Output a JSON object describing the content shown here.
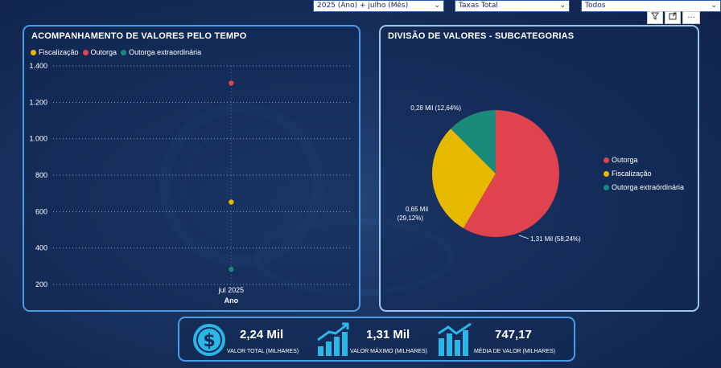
{
  "slicers": {
    "period": "2025 (Ano) + julho (Mês)",
    "taxa": "Taxas Total",
    "todos": "Todos"
  },
  "toolbar": {
    "filter_icon": "filter-icon",
    "focus_icon": "focus-mode-icon",
    "more_label": "···"
  },
  "timeline": {
    "title": "ACOMPANHAMENTO DE VALORES PELO TEMPO",
    "legend": [
      {
        "label": "Fiscalização",
        "color": "#e6b800"
      },
      {
        "label": "Outorga",
        "color": "#e0434d"
      },
      {
        "label": "Outorga extraordinária",
        "color": "#1a8a7a"
      }
    ],
    "x_tick": "jul 2025",
    "x_axis_label": "Ano"
  },
  "pie": {
    "title": "DIVISÃO DE VALORES - SUBCATEGORIAS",
    "legend": [
      {
        "label": "Outorga",
        "color": "#e0434d"
      },
      {
        "label": "Fiscalização",
        "color": "#e6b800"
      },
      {
        "label": "Outorga extraórdinária",
        "color": "#1a8a7a"
      }
    ],
    "labels": {
      "small_line1": "0,28 Mil (12,64%)",
      "mid_line1": "0,65 Mil",
      "mid_line2": "(29,12%)",
      "large_line1": "1,31 Mil (58,24%)"
    }
  },
  "kpis": [
    {
      "value": "2,24 Mil",
      "label": "VALOR TOTAL (MILHARES)",
      "icon": "dollar-coin-icon"
    },
    {
      "value": "1,31 Mil",
      "label": "VALOR MÁXIMO (MILHARES)",
      "icon": "growth-bars-icon"
    },
    {
      "value": "747,17",
      "label": "MÉDIA DE VALOR (MILHARES)",
      "icon": "trend-bars-icon"
    }
  ],
  "chart_data": [
    {
      "type": "scatter",
      "title": "ACOMPANHAMENTO DE VALORES PELO TEMPO",
      "xlabel": "Ano",
      "ylabel": "",
      "categories": [
        "jul 2025"
      ],
      "y_ticks": [
        "200",
        "400",
        "600",
        "800",
        "1.000",
        "1.200",
        "1.400"
      ],
      "ylim": [
        150,
        1400
      ],
      "grid": true,
      "legend_position": "top-left",
      "series": [
        {
          "name": "Fiscalização",
          "values": [
            652.3
          ],
          "color": "#e6b800"
        },
        {
          "name": "Outorga",
          "values": [
            1305.6
          ],
          "color": "#e0434d"
        },
        {
          "name": "Outorga extraordinária",
          "values": [
            283.3
          ],
          "color": "#1a8a7a"
        }
      ]
    },
    {
      "type": "pie",
      "title": "DIVISÃO DE VALORES - SUBCATEGORIAS",
      "legend_position": "right",
      "slices": [
        {
          "name": "Outorga",
          "value": 1.31,
          "percent": 58.24,
          "color": "#e0434d"
        },
        {
          "name": "Fiscalização",
          "value": 0.65,
          "percent": 29.12,
          "color": "#e6b800"
        },
        {
          "name": "Outorga extraórdinária",
          "value": 0.28,
          "percent": 12.64,
          "color": "#1a8a7a"
        }
      ]
    }
  ]
}
